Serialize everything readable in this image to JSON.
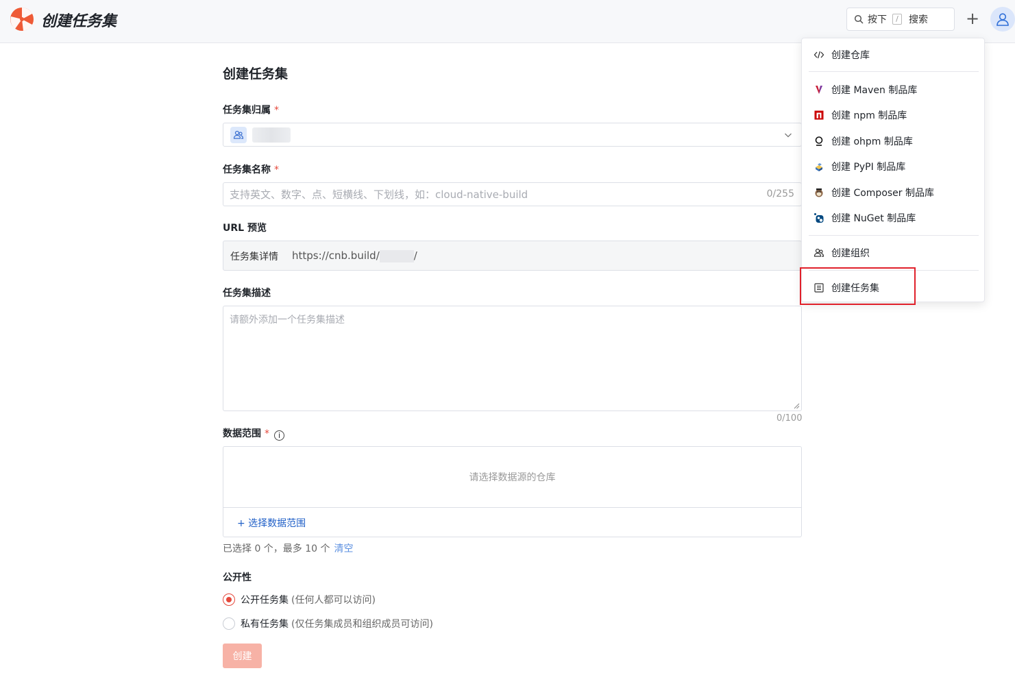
{
  "header": {
    "title": "创建任务集",
    "search": {
      "prefix": "按下",
      "key": "/",
      "label": "搜索"
    },
    "plus_label": "+"
  },
  "form": {
    "page_title": "创建任务集",
    "owner": {
      "label": "任务集归属",
      "required_mark": "*"
    },
    "name": {
      "label": "任务集名称",
      "required_mark": "*",
      "placeholder": "支持英文、数字、点、短横线、下划线，如：cloud-native-build",
      "counter": "0/255"
    },
    "url_preview": {
      "label": "URL 预览",
      "prefix": "任务集详情",
      "url_start": "https://cnb.build/",
      "url_end": "/"
    },
    "description": {
      "label": "任务集描述",
      "placeholder": "请额外添加一个任务集描述",
      "counter": "0/100"
    },
    "scope": {
      "label": "数据范围",
      "required_mark": "*",
      "info": "i",
      "empty_text": "请选择数据源的仓库",
      "add_label": "+ 选择数据范围",
      "hint": "已选择 0 个，最多 10 个",
      "clear_label": "清空"
    },
    "visibility": {
      "label": "公开性",
      "options": [
        {
          "label": "公开任务集",
          "sub": "(任何人都可以访问)",
          "checked": true
        },
        {
          "label": "私有任务集",
          "sub": "(仅任务集成员和组织成员可访问)",
          "checked": false
        }
      ]
    },
    "submit_label": "创建"
  },
  "dropdown": {
    "items": [
      {
        "label": "创建仓库",
        "icon": "code-icon"
      },
      {
        "label": "创建 Maven 制品库",
        "icon": "maven-icon"
      },
      {
        "label": "创建 npm 制品库",
        "icon": "npm-icon"
      },
      {
        "label": "创建 ohpm 制品库",
        "icon": "ohpm-icon"
      },
      {
        "label": "创建 PyPI 制品库",
        "icon": "pypi-icon"
      },
      {
        "label": "创建 Composer 制品库",
        "icon": "composer-icon"
      },
      {
        "label": "创建 NuGet 制品库",
        "icon": "nuget-icon"
      },
      {
        "label": "创建组织",
        "icon": "organization-icon"
      },
      {
        "label": "创建任务集",
        "icon": "task-list-icon"
      }
    ],
    "highlight_color": "#e0202a"
  },
  "colors": {
    "accent": "#e5483b",
    "link": "#1f5fc7",
    "button_disabled": "#f7b2a6"
  }
}
